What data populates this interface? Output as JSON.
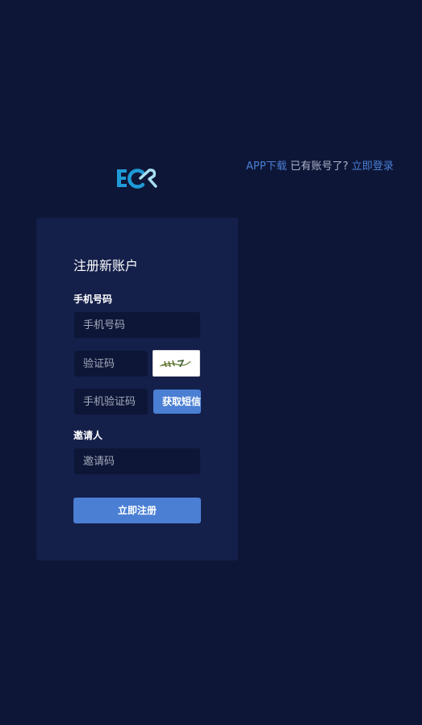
{
  "header": {
    "app_download": "APP下载",
    "have_account": "已有账号了?",
    "login_now": "立即登录"
  },
  "form": {
    "title": "注册新账户",
    "phone_label": "手机号码",
    "phone_placeholder": "手机号码",
    "captcha_placeholder": "验证码",
    "sms_code_placeholder": "手机验证码",
    "get_sms_button": "获取短信验证码",
    "inviter_label": "邀请人",
    "invite_code_placeholder": "邀请码",
    "submit_label": "立即注册"
  },
  "colors": {
    "background": "#0e1637",
    "card": "#141f4a",
    "accent": "#4a7fd4",
    "logo_blue": "#1e9ad6",
    "logo_light": "#a9dff0"
  },
  "icons": {
    "logo": "ecr-logo",
    "captcha": "captcha-image"
  }
}
